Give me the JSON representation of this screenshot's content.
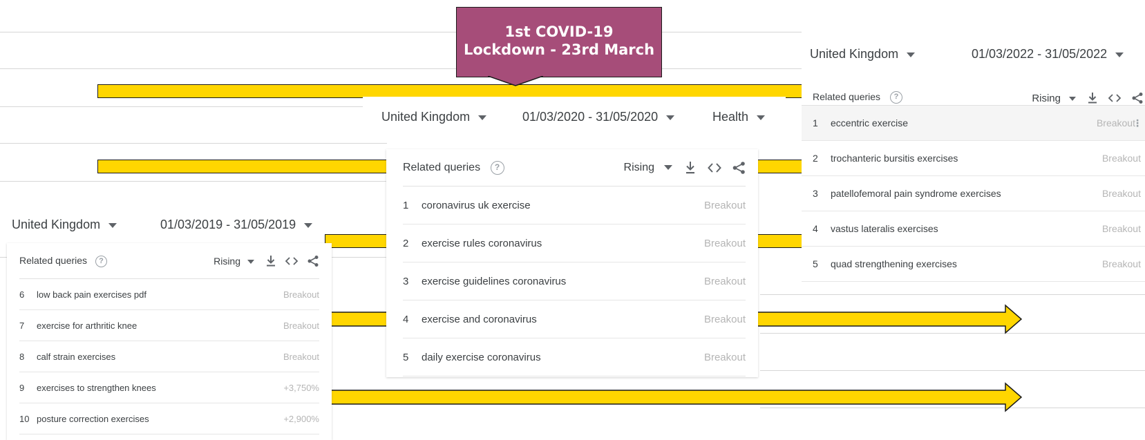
{
  "callout": {
    "line1": "1st COVID-19",
    "line2": "Lockdown - 23rd March"
  },
  "panels": {
    "y2019": {
      "region": "United Kingdom",
      "range": "01/03/2019 - 31/05/2019",
      "title": "Related queries",
      "mode": "Rising",
      "rows": [
        {
          "rank": "6",
          "query": "low back pain exercises pdf",
          "value": "Breakout"
        },
        {
          "rank": "7",
          "query": "exercise for arthritic knee",
          "value": "Breakout"
        },
        {
          "rank": "8",
          "query": "calf strain exercises",
          "value": "Breakout"
        },
        {
          "rank": "9",
          "query": "exercises to strengthen knees",
          "value": "+3,750%"
        },
        {
          "rank": "10",
          "query": "posture correction exercises",
          "value": "+2,900%"
        }
      ]
    },
    "y2020": {
      "region": "United Kingdom",
      "range": "01/03/2020 - 31/05/2020",
      "category": "Health",
      "title": "Related queries",
      "mode": "Rising",
      "rows": [
        {
          "rank": "1",
          "query": "coronavirus uk exercise",
          "value": "Breakout"
        },
        {
          "rank": "2",
          "query": "exercise rules coronavirus",
          "value": "Breakout"
        },
        {
          "rank": "3",
          "query": "exercise guidelines coronavirus",
          "value": "Breakout"
        },
        {
          "rank": "4",
          "query": "exercise and coronavirus",
          "value": "Breakout"
        },
        {
          "rank": "5",
          "query": "daily exercise coronavirus",
          "value": "Breakout"
        }
      ]
    },
    "y2022": {
      "region": "United Kingdom",
      "range": "01/03/2022 - 31/05/2022",
      "title": "Related queries",
      "mode": "Rising",
      "rows": [
        {
          "rank": "1",
          "query": "eccentric exercise",
          "value": "Breakout"
        },
        {
          "rank": "2",
          "query": "trochanteric bursitis exercises",
          "value": "Breakout"
        },
        {
          "rank": "3",
          "query": "patellofemoral pain syndrome exercises",
          "value": "Breakout"
        },
        {
          "rank": "4",
          "query": "vastus lateralis exercises",
          "value": "Breakout"
        },
        {
          "rank": "5",
          "query": "quad strengthening exercises",
          "value": "Breakout"
        }
      ]
    }
  },
  "colors": {
    "callout_bg": "#a64d79",
    "arrow_fill": "#ffd600",
    "breakout_text": "#b5b5b5"
  },
  "icons": [
    "help-circle-icon",
    "download-icon",
    "embed-code-icon",
    "share-icon",
    "dropdown-caret-icon",
    "more-vert-icon"
  ]
}
